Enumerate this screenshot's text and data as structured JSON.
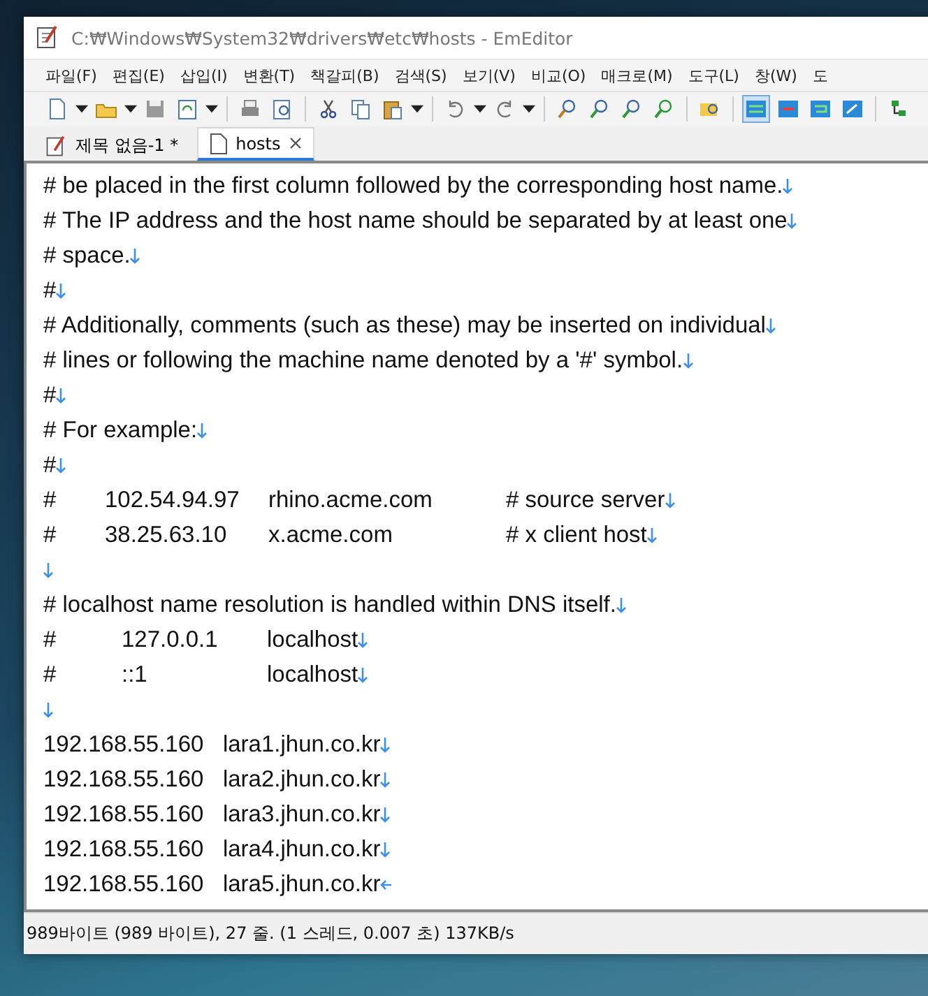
{
  "window": {
    "title": "C:₩Windows₩System32₩drivers₩etc₩hosts - EmEditor"
  },
  "menu": [
    "파일(F)",
    "편집(E)",
    "삽입(I)",
    "변환(T)",
    "책갈피(B)",
    "검색(S)",
    "보기(V)",
    "비교(O)",
    "매크로(M)",
    "도구(L)",
    "창(W)",
    "도"
  ],
  "tabs": [
    {
      "label": "제목 없음-1 *",
      "selected": false
    },
    {
      "label": "hosts",
      "selected": true
    }
  ],
  "editor": {
    "lines": [
      {
        "text": "# be placed in the first column followed by the corresponding host name.",
        "end_of_file": false
      },
      {
        "text": "# The IP address and the host name should be separated by at least one",
        "end_of_file": false
      },
      {
        "text": "# space.",
        "end_of_file": false
      },
      {
        "text": "#",
        "end_of_file": false
      },
      {
        "text": "# Additionally, comments (such as these) may be inserted on individual",
        "end_of_file": false
      },
      {
        "text": "# lines or following the machine name denoted by a '#' symbol.",
        "end_of_file": false
      },
      {
        "text": "#",
        "end_of_file": false
      },
      {
        "text": "# For example:",
        "end_of_file": false
      },
      {
        "text": "#",
        "end_of_file": false
      },
      {
        "cols": [
          "#",
          "102.54.94.97",
          "rhino.acme.com",
          "# source server"
        ],
        "end_of_file": false
      },
      {
        "cols": [
          "#",
          "38.25.63.10",
          "x.acme.com",
          "# x client host"
        ],
        "end_of_file": false
      },
      {
        "end_of_file": false
      },
      {
        "text": "# localhost name resolution is handled within DNS itself.",
        "end_of_file": false
      },
      {
        "cols": [
          "#",
          "127.0.0.1",
          "localhost"
        ],
        "end_of_file": false
      },
      {
        "cols": [
          "#",
          "::1",
          "localhost"
        ],
        "end_of_file": false
      },
      {
        "end_of_file": false
      },
      {
        "text": "192.168.55.160   lara1.jhun.co.kr",
        "end_of_file": false
      },
      {
        "text": "192.168.55.160   lara2.jhun.co.kr",
        "end_of_file": false
      },
      {
        "text": "192.168.55.160   lara3.jhun.co.kr",
        "end_of_file": false
      },
      {
        "text": "192.168.55.160   lara4.jhun.co.kr",
        "end_of_file": false
      },
      {
        "text": "192.168.55.160   lara5.jhun.co.kr",
        "end_of_file": true
      }
    ]
  },
  "status_bar": "989바이트 (989 바이트), 27 줄. (1 스레드, 0.007 초) 137KB/s"
}
